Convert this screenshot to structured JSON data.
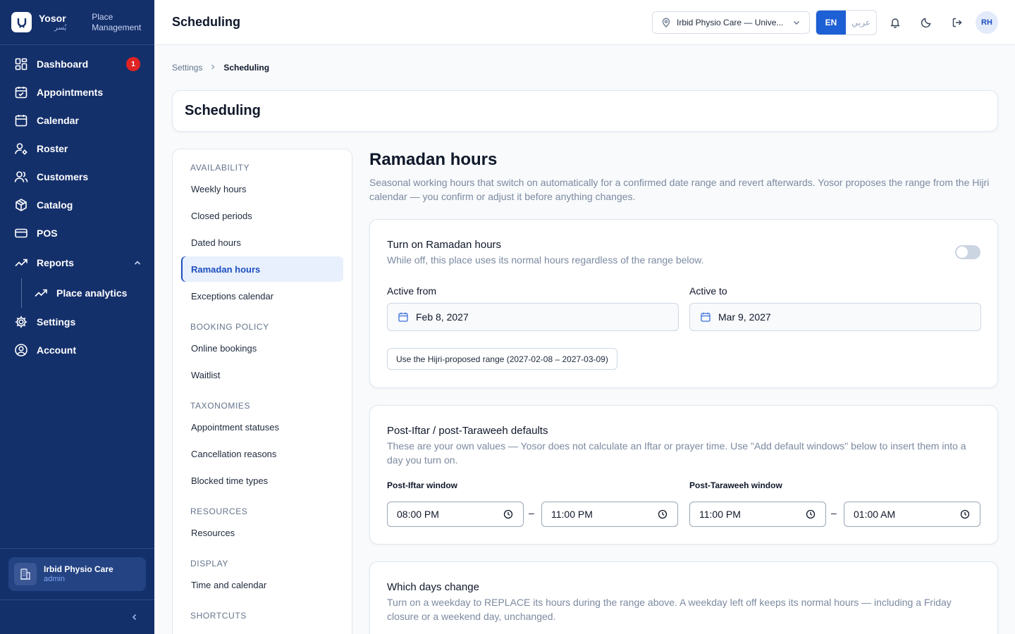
{
  "brand": {
    "name": "Yosor",
    "name_ar": "يُسر",
    "subtitle_1": "Place",
    "subtitle_2": "Management"
  },
  "sidebar": {
    "items": [
      {
        "label": "Dashboard",
        "badge": "1"
      },
      {
        "label": "Appointments"
      },
      {
        "label": "Calendar"
      },
      {
        "label": "Roster"
      },
      {
        "label": "Customers"
      },
      {
        "label": "Catalog"
      },
      {
        "label": "POS"
      },
      {
        "label": "Reports"
      },
      {
        "label": "Place analytics"
      },
      {
        "label": "Settings"
      },
      {
        "label": "Account"
      }
    ],
    "org": {
      "name": "Irbid Physio Care",
      "role": "admin"
    }
  },
  "topbar": {
    "title": "Scheduling",
    "place": "Irbid Physio Care — Unive...",
    "lang_en": "EN",
    "lang_ar": "عربي",
    "avatar": "RH"
  },
  "breadcrumb": {
    "parent": "Settings",
    "current": "Scheduling"
  },
  "page_title": "Scheduling",
  "submenu": {
    "groups": [
      {
        "label": "AVAILABILITY",
        "items": [
          "Weekly hours",
          "Closed periods",
          "Dated hours",
          "Ramadan hours",
          "Exceptions calendar"
        ]
      },
      {
        "label": "BOOKING POLICY",
        "items": [
          "Online bookings",
          "Waitlist"
        ]
      },
      {
        "label": "TAXONOMIES",
        "items": [
          "Appointment statuses",
          "Cancellation reasons",
          "Blocked time types"
        ]
      },
      {
        "label": "RESOURCES",
        "items": [
          "Resources"
        ]
      },
      {
        "label": "DISPLAY",
        "items": [
          "Time and calendar"
        ]
      },
      {
        "label": "SHORTCUTS",
        "items": []
      }
    ],
    "active": "Ramadan hours"
  },
  "content": {
    "heading": "Ramadan hours",
    "description": "Seasonal working hours that switch on automatically for a confirmed date range and revert afterwards. Yosor proposes the range from the Hijri calendar — you confirm or adjust it before anything changes.",
    "toggle_card": {
      "title": "Turn on Ramadan hours",
      "description": "While off, this place uses its normal hours regardless of the range below.",
      "enabled": false,
      "active_from_label": "Active from",
      "active_from": "Feb 8, 2027",
      "active_to_label": "Active to",
      "active_to": "Mar 9, 2027",
      "hijri_button": "Use the Hijri-proposed range (2027-02-08 – 2027-03-09)"
    },
    "defaults_card": {
      "title": "Post-Iftar / post-Taraweeh defaults",
      "description": "These are your own values — Yosor does not calculate an Iftar or prayer time. Use \"Add default windows\" below to insert them into a day you turn on.",
      "iftar_label": "Post-Iftar window",
      "iftar_start": "08:00 PM",
      "iftar_end": "11:00 PM",
      "taraweeh_label": "Post-Taraweeh window",
      "taraweeh_start": "11:00 PM",
      "taraweeh_end": "01:00 AM",
      "separator": "–"
    },
    "days_card": {
      "title": "Which days change",
      "description": "Turn on a weekday to REPLACE its hours during the range above. A weekday left off keeps its normal hours — including a Friday closure or a weekend day, unchanged."
    }
  },
  "colors": {
    "sidebar": "#14306b",
    "accent": "#1d5fd4",
    "badge": "#e02424"
  }
}
